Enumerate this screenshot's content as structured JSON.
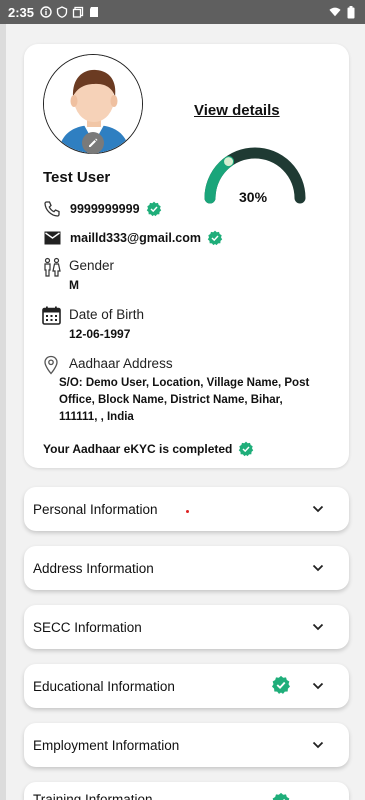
{
  "status_bar": {
    "time": "2:35"
  },
  "profile": {
    "view_details_label": "View details",
    "completion_percent": "30%",
    "completion_fraction": 0.3,
    "name": "Test User",
    "phone": "9999999999",
    "email": "mailld333@gmail.com",
    "gender_label": "Gender",
    "gender_value": "M",
    "dob_label": "Date of Birth",
    "dob_value": "12-06-1997",
    "address_label": "Aadhaar Address",
    "address_value": "S/O: Demo User, Location, Village Name, Post Office, Block Name, District Name, Bihar, 111111, , India",
    "ekyc_text": "Your Aadhaar eKYC is completed"
  },
  "sections": [
    {
      "title": "Personal Information",
      "verified": false
    },
    {
      "title": "Address Information",
      "verified": false
    },
    {
      "title": "SECC Information",
      "verified": false
    },
    {
      "title": "Educational Information",
      "verified": true
    },
    {
      "title": "Employment Information",
      "verified": false
    },
    {
      "title": "Training Information",
      "verified": true
    }
  ],
  "colors": {
    "accent_green": "#1aa57a",
    "gauge_dark": "#1f3a33",
    "verified_green": "#1fae7a"
  },
  "icons": [
    "phone-icon",
    "mail-icon",
    "gender-icon",
    "calendar-icon",
    "location-icon",
    "pencil-icon",
    "chevron-down-icon",
    "verified-icon"
  ]
}
